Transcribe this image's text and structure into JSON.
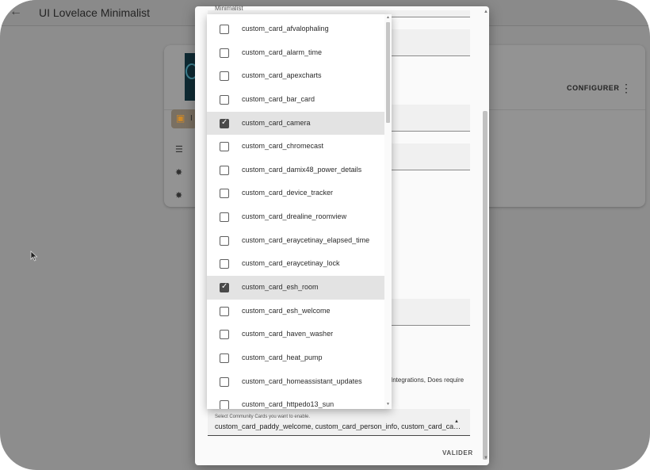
{
  "app": {
    "title": "UI Lovelace Minimalist"
  },
  "background_card": {
    "configure_label": "CONFIGURER",
    "info_letter": "I"
  },
  "dialog": {
    "top_field_text": "Minimalist",
    "partial_text": "Integrations, Does require",
    "select_label": "Select Community Cards you want to enable.",
    "select_value": "custom_card_paddy_welcome, custom_card_person_info, custom_card_camera, custom_card_esh_room",
    "submit_label": "VALIDER"
  },
  "dropdown": {
    "items": [
      {
        "label": "custom_card_afvalophaling",
        "checked": false
      },
      {
        "label": "custom_card_alarm_time",
        "checked": false
      },
      {
        "label": "custom_card_apexcharts",
        "checked": false
      },
      {
        "label": "custom_card_bar_card",
        "checked": false
      },
      {
        "label": "custom_card_camera",
        "checked": true
      },
      {
        "label": "custom_card_chromecast",
        "checked": false
      },
      {
        "label": "custom_card_damix48_power_details",
        "checked": false
      },
      {
        "label": "custom_card_device_tracker",
        "checked": false
      },
      {
        "label": "custom_card_drealine_roomview",
        "checked": false
      },
      {
        "label": "custom_card_eraycetinay_elapsed_time",
        "checked": false
      },
      {
        "label": "custom_card_eraycetinay_lock",
        "checked": false
      },
      {
        "label": "custom_card_esh_room",
        "checked": true
      },
      {
        "label": "custom_card_esh_welcome",
        "checked": false
      },
      {
        "label": "custom_card_haven_washer",
        "checked": false
      },
      {
        "label": "custom_card_heat_pump",
        "checked": false
      },
      {
        "label": "custom_card_homeassistant_updates",
        "checked": false
      },
      {
        "label": "custom_card_httpedo13_sun",
        "checked": false
      }
    ]
  },
  "colors": {
    "overlay": "#8d8d8d",
    "checked_row": "#e3e3e3",
    "accent_icon": "#d08a27"
  }
}
